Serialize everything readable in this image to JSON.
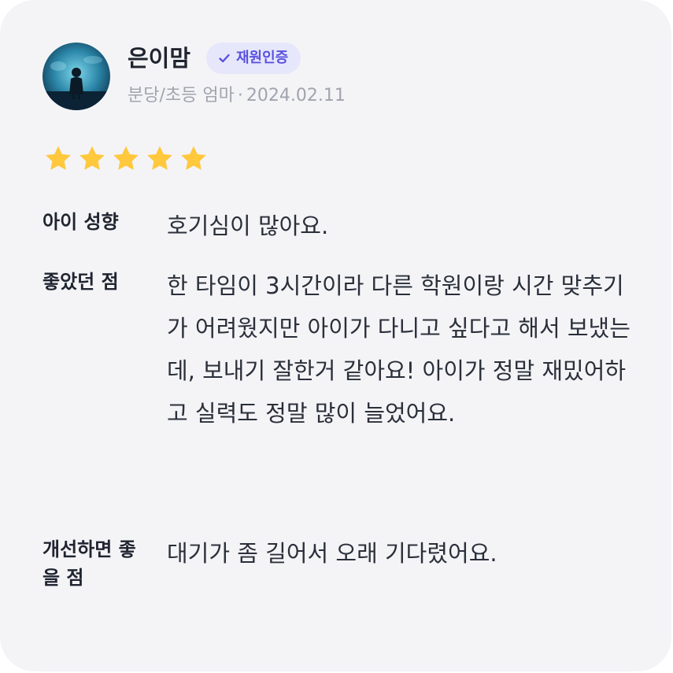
{
  "review": {
    "author": {
      "name": "은이맘",
      "badge_label": "재원인증",
      "badge_icon": "checkmark-icon",
      "location": "분당/초등 엄마",
      "separator": "·",
      "date": "2024.02.11"
    },
    "rating": {
      "value": 5,
      "max": 5,
      "star_color": "#ffc83d"
    },
    "sections": [
      {
        "label": "아이 성향",
        "text": "호기심이 많아요."
      },
      {
        "label": "좋았던 점",
        "text": "한 타임이 3시간이라 다른 학원이랑 시간 맞추기가 어려웠지만 아이가 다니고 싶다고 해서 보냈는데, 보내기 잘한거 같아요! 아이가 정말 재밌어하고 실력도 정말 많이 늘었어요."
      },
      {
        "label": "개선하면 좋을 점",
        "text": "대기가 좀 길어서 오래 기다렸어요."
      }
    ],
    "colors": {
      "card_background": "#f4f4f7",
      "badge_background": "#e6e7fb",
      "badge_text": "#5a52e0",
      "meta_text": "#a1a4ae"
    }
  }
}
